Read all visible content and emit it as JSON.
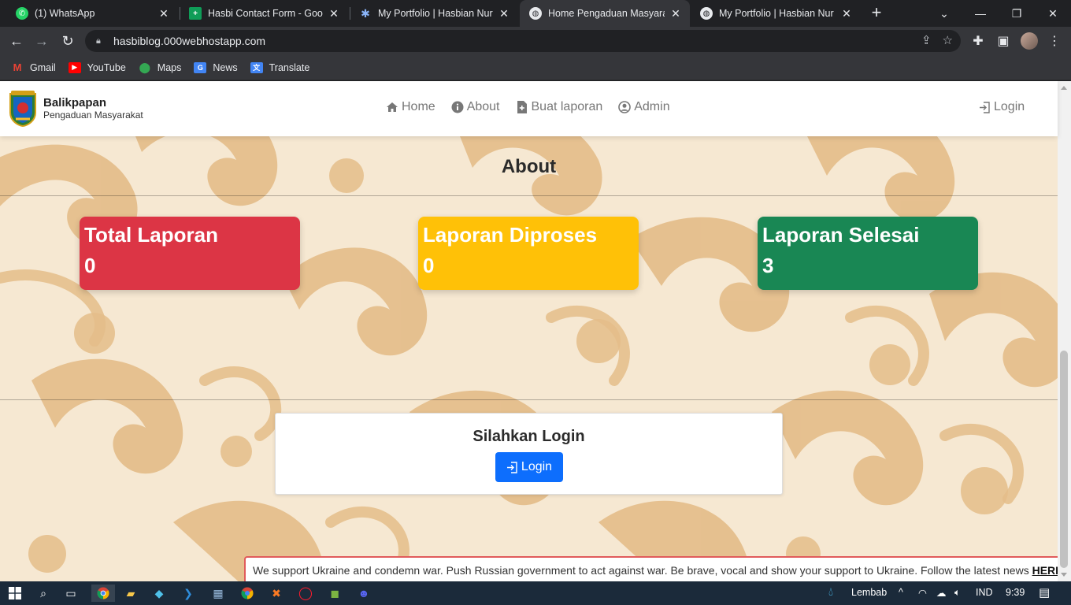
{
  "browser": {
    "tabs": [
      {
        "title": "(1) WhatsApp",
        "icon": "whatsapp-icon",
        "color": "#25d366",
        "active": false
      },
      {
        "title": "Hasbi Contact Form - Google",
        "icon": "google-forms-icon",
        "color": "#0f9d58",
        "active": false
      },
      {
        "title": "My Portfolio | Hasbian Nur",
        "icon": "star-icon",
        "color": "#5b7fd6",
        "active": false
      },
      {
        "title": "Home Pengaduan Masyarakat",
        "icon": "globe-icon",
        "color": "#e8eaed",
        "active": true
      },
      {
        "title": "My Portfolio | Hasbian Nur",
        "icon": "globe-icon",
        "color": "#e8eaed",
        "active": false
      }
    ],
    "address": "hasbiblog.000webhostapp.com",
    "bookmarks": [
      {
        "label": "Gmail",
        "icon": "gmail-icon",
        "color": "#ea4335"
      },
      {
        "label": "YouTube",
        "icon": "youtube-icon",
        "color": "#ff0000"
      },
      {
        "label": "Maps",
        "icon": "maps-icon",
        "color": "#34a853"
      },
      {
        "label": "News",
        "icon": "news-icon",
        "color": "#4285f4"
      },
      {
        "label": "Translate",
        "icon": "translate-icon",
        "color": "#4285f4"
      }
    ]
  },
  "site": {
    "brand_name": "Balikpapan",
    "brand_sub": "Pengaduan Masyarakat",
    "nav": [
      {
        "label": "Home",
        "icon": "home-icon"
      },
      {
        "label": "About",
        "icon": "info-icon"
      },
      {
        "label": "Buat laporan",
        "icon": "file-plus-icon"
      },
      {
        "label": "Admin",
        "icon": "user-circle-icon"
      }
    ],
    "login_link": "Login"
  },
  "about": {
    "title": "About",
    "cards": [
      {
        "title": "Total Laporan",
        "value": "0",
        "color": "#dc3545"
      },
      {
        "title": "Laporan Diproses",
        "value": "0",
        "color": "#ffc107"
      },
      {
        "title": "Laporan Selesai",
        "value": "3",
        "color": "#198754"
      }
    ]
  },
  "login_panel": {
    "title": "Silahkan Login",
    "button": "Login"
  },
  "banner": {
    "text": "We support Ukraine and condemn war. Push Russian government to act against war. Be brave, vocal and show your support to Ukraine. Follow the latest news",
    "link": "HERE"
  },
  "taskbar": {
    "weather": "Lembab",
    "language": "IND",
    "time": "9:39"
  }
}
